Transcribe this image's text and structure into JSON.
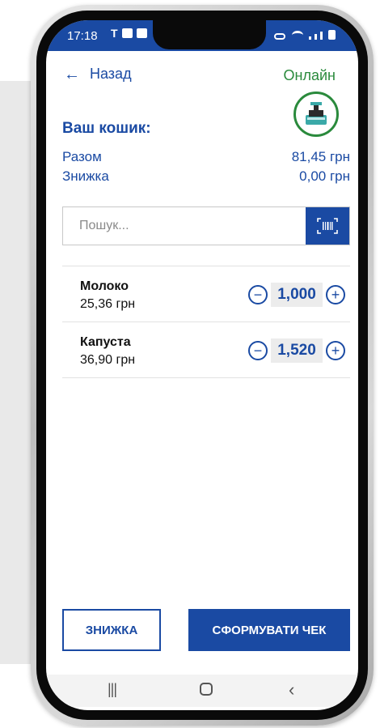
{
  "status_bar": {
    "time": "17:18",
    "left_icons": [
      "T",
      "image-icon",
      "youtube-icon"
    ],
    "right_icons": [
      "key-icon",
      "wifi-icon",
      "signal-icon",
      "signal-icon",
      "battery-icon"
    ]
  },
  "header": {
    "back_label": "Назад",
    "status_label": "Онлайн",
    "status_color": "#2a8a3c"
  },
  "cart": {
    "title": "Ваш кошик:",
    "total_label": "Разом",
    "total_value": "81,45 грн",
    "discount_label": "Знижка",
    "discount_value": "0,00 грн"
  },
  "search": {
    "placeholder": "Пошук..."
  },
  "items": [
    {
      "name": "Молоко",
      "price": "25,36 грн",
      "quantity": "1,000"
    },
    {
      "name": "Капуста",
      "price": "36,90 грн",
      "quantity": "1,520"
    }
  ],
  "actions": {
    "discount_button": "ЗНИЖКА",
    "create_check_button": "СФОРМУВАТИ ЧЕК"
  },
  "colors": {
    "accent": "#1a4aa3",
    "online": "#2a8a3c"
  }
}
